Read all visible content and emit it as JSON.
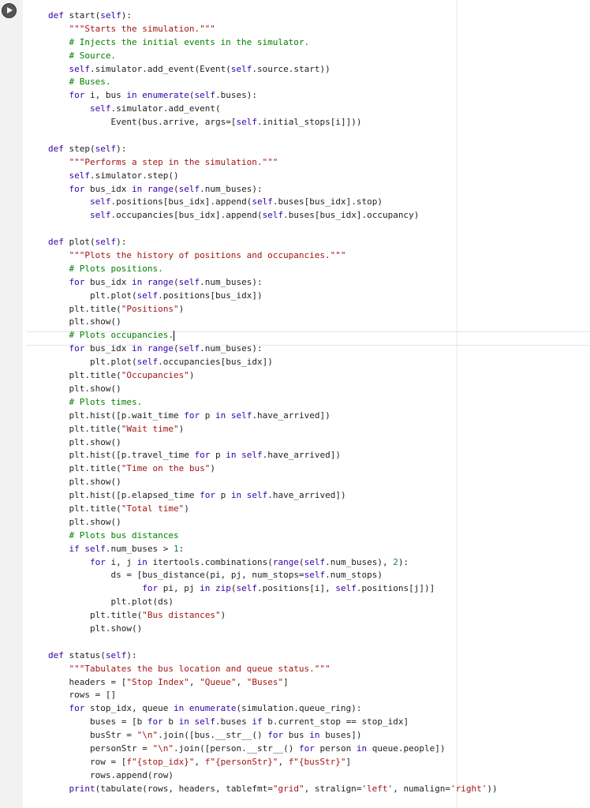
{
  "cell": {
    "run_button_icon": "play-icon",
    "lines": [
      "def start(self):",
      "    \"\"\"Starts the simulation.\"\"\"",
      "    # Injects the initial events in the simulator.",
      "    # Source.",
      "    self.simulator.add_event(Event(self.source.start))",
      "    # Buses.",
      "    for i, bus in enumerate(self.buses):",
      "        self.simulator.add_event(",
      "            Event(bus.arrive, args=[self.initial_stops[i]]))",
      "",
      "def step(self):",
      "    \"\"\"Performs a step in the simulation.\"\"\"",
      "    self.simulator.step()",
      "    for bus_idx in range(self.num_buses):",
      "        self.positions[bus_idx].append(self.buses[bus_idx].stop)",
      "        self.occupancies[bus_idx].append(self.buses[bus_idx].occupancy)",
      "",
      "def plot(self):",
      "    \"\"\"Plots the history of positions and occupancies.\"\"\"",
      "    # Plots positions.",
      "    for bus_idx in range(self.num_buses):",
      "        plt.plot(self.positions[bus_idx])",
      "    plt.title(\"Positions\")",
      "    plt.show()",
      "    # Plots occupancies.",
      "    for bus_idx in range(self.num_buses):",
      "        plt.plot(self.occupancies[bus_idx])",
      "    plt.title(\"Occupancies\")",
      "    plt.show()",
      "    # Plots times.",
      "    plt.hist([p.wait_time for p in self.have_arrived])",
      "    plt.title(\"Wait time\")",
      "    plt.show()",
      "    plt.hist([p.travel_time for p in self.have_arrived])",
      "    plt.title(\"Time on the bus\")",
      "    plt.show()",
      "    plt.hist([p.elapsed_time for p in self.have_arrived])",
      "    plt.title(\"Total time\")",
      "    plt.show()",
      "    # Plots bus distances",
      "    if self.num_buses > 1:",
      "        for i, j in itertools.combinations(range(self.num_buses), 2):",
      "            ds = [bus_distance(pi, pj, num_stops=self.num_stops)",
      "                  for pi, pj in zip(self.positions[i], self.positions[j])]",
      "            plt.plot(ds)",
      "        plt.title(\"Bus distances\")",
      "        plt.show()",
      "",
      "def status(self):",
      "    \"\"\"Tabulates the bus location and queue status.\"\"\"",
      "    headers = [\"Stop Index\", \"Queue\", \"Buses\"]",
      "    rows = []",
      "    for stop_idx, queue in enumerate(simulation.queue_ring):",
      "        buses = [b for b in self.buses if b.current_stop == stop_idx]",
      "        busStr = \"\\n\".join([bus.__str__() for bus in buses])",
      "        personStr = \"\\n\".join([person.__str__() for person in queue.people])",
      "        row = [f\"{stop_idx}\", f\"{personStr}\", f\"{busStr}\"]",
      "        rows.append(row)",
      "    print(tabulate(rows, headers, tablefmt=\"grid\", stralign='left', numalign='right'))"
    ],
    "cursor_line_index": 24,
    "colors": {
      "keyword": "#3300aa",
      "string": "#a31515",
      "comment": "#008000",
      "number": "#098658"
    }
  }
}
